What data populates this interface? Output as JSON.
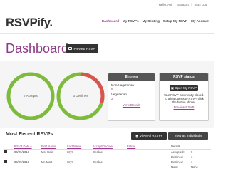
{
  "topbar": {
    "greeting": "Hello, Avi",
    "support": "Support",
    "signout": "Sign Out",
    "sep": "|"
  },
  "logo": "RSVPify.",
  "nav": [
    {
      "label": "Dashboard",
      "active": true
    },
    {
      "label": "My RSVPs"
    },
    {
      "label": "My Seating"
    },
    {
      "label": "Setup My RSVP"
    },
    {
      "label": "My Account"
    }
  ],
  "page_title": "Dashboard",
  "preview_button": "Preview RSVP",
  "donuts": [
    {
      "label": "7 Accepts",
      "color": "#7dbb3b"
    },
    {
      "label": "3 Declines",
      "color": "#d9534f"
    }
  ],
  "entrees": {
    "title": "Entrees",
    "items": [
      {
        "name": "Non-Vegetarian",
        "count": "5"
      },
      {
        "name": "Vegetarian",
        "count": "2"
      }
    ],
    "link": "View Details"
  },
  "rsvp_status": {
    "title": "RSVP status",
    "button": "Open My RSVP",
    "text_1": "Your RSVP is currently closed.",
    "text_2": "To allow guests to RSVP, click",
    "text_3": "the button above.",
    "link": "Preview RSVP"
  },
  "recent": {
    "title": "Most Recent RSVPs",
    "view_all": "View All RSVPs",
    "view_individuals": "View as Individuals",
    "columns": [
      "RSVP Date ▾",
      "First Name",
      "Last Name",
      "Accept/Decline",
      "Entree",
      "Details"
    ],
    "rows": [
      {
        "date": "06/29/2013",
        "first": "Ms. Gela",
        "last": "Crys",
        "status": "Decline",
        "entree": "",
        "d1k": "Accepted:",
        "d1v": "0",
        "d2k": "Declined:",
        "d2v": "1"
      },
      {
        "date": "06/29/2013",
        "first": "Mr. Matt",
        "last": "Crys",
        "status": "Decline",
        "entree": "",
        "d1k": "Declined:",
        "d1v": "1",
        "d2k": "",
        "d2v": ""
      },
      {
        "date": "",
        "first": "",
        "last": "",
        "status": "",
        "entree": "",
        "d1k": "Note:",
        "d1v": "None",
        "d2k": "",
        "d2v": ""
      }
    ]
  },
  "colors": {
    "accent": "#9b3d8c",
    "dark": "#333333"
  }
}
